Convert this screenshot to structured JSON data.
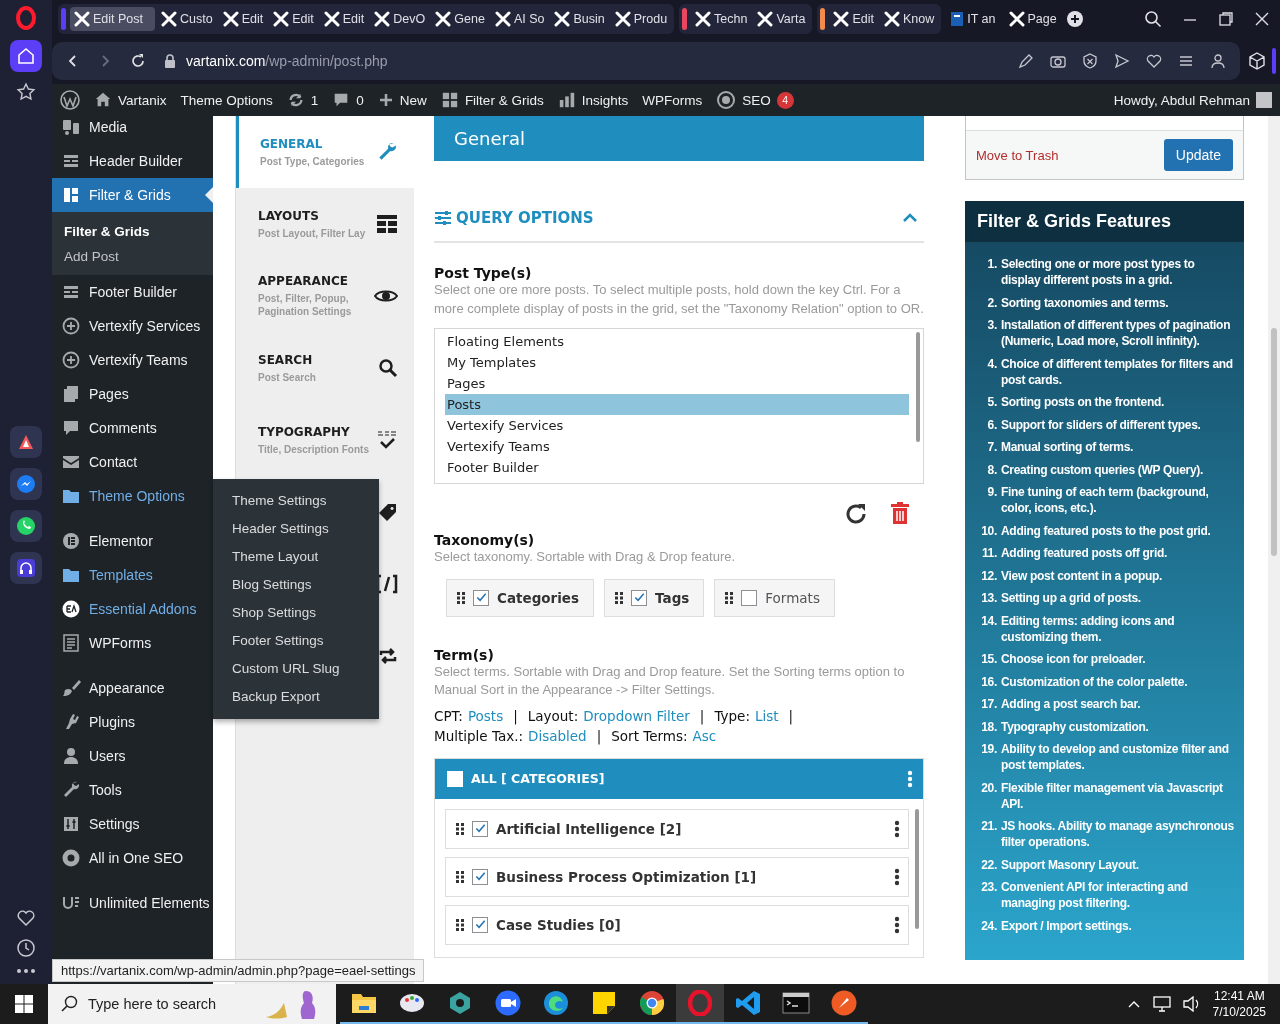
{
  "browser": {
    "tab_groups": [
      {
        "color": "#5b3ef5",
        "tabs": [
          {
            "title": "Edit Post",
            "selected": true
          },
          {
            "title": "Custo",
            "selected": false
          },
          {
            "title": "Edit",
            "selected": false
          },
          {
            "title": "Edit",
            "selected": false
          },
          {
            "title": "Edit",
            "selected": false
          },
          {
            "title": "DevO",
            "selected": false
          },
          {
            "title": "Gene",
            "selected": false
          },
          {
            "title": "AI So",
            "selected": false
          },
          {
            "title": "Busin",
            "selected": false
          },
          {
            "title": "Produ",
            "selected": false
          }
        ]
      },
      {
        "color": "#e8475f",
        "tabs": [
          {
            "title": "Techn",
            "selected": false
          },
          {
            "title": "Varta",
            "selected": false
          }
        ]
      },
      {
        "color": "#f28b4c",
        "tabs": [
          {
            "title": "Edit",
            "selected": false
          },
          {
            "title": "Know",
            "selected": false
          }
        ]
      }
    ],
    "loose_tabs": [
      {
        "title": "IT an",
        "selected": false,
        "kind": "doc"
      },
      {
        "title": "Page",
        "selected": false,
        "kind": "x"
      }
    ],
    "address": {
      "host": "vartanix.com",
      "path": "/wp-admin/post.php"
    },
    "status_url": "https://vartanix.com/wp-admin/admin.php?page=eael-settings"
  },
  "admin_bar": {
    "items": [
      {
        "kind": "home",
        "label": "Vartanix"
      },
      {
        "kind": "text",
        "label": "Theme Options"
      },
      {
        "kind": "updates",
        "label": "1"
      },
      {
        "kind": "comments",
        "label": "0"
      },
      {
        "kind": "new",
        "label": "New"
      },
      {
        "kind": "grid",
        "label": "Filter & Grids"
      },
      {
        "kind": "insights",
        "label": "Insights"
      },
      {
        "kind": "text",
        "label": "WPForms"
      },
      {
        "kind": "seo",
        "label": "SEO",
        "badge": "4"
      }
    ],
    "greeting": "Howdy, Abdul Rehman"
  },
  "admin_menu": [
    {
      "items": [
        {
          "kind": "media",
          "label": "Media",
          "current": false,
          "highlighted": false
        },
        {
          "kind": "builder",
          "label": "Header Builder",
          "current": false,
          "highlighted": false
        },
        {
          "kind": "grid",
          "label": "Filter & Grids",
          "current": true,
          "highlighted": false,
          "submenu": [
            {
              "label": "Filter & Grids",
              "current": true
            },
            {
              "label": "Add Post",
              "current": false
            }
          ]
        },
        {
          "kind": "builder",
          "label": "Footer Builder",
          "current": false,
          "highlighted": false
        },
        {
          "kind": "plus",
          "label": "Vertexify Services",
          "current": false,
          "highlighted": false
        },
        {
          "kind": "plus",
          "label": "Vertexify Teams",
          "current": false,
          "highlighted": false
        },
        {
          "kind": "pages",
          "label": "Pages",
          "current": false,
          "highlighted": false
        },
        {
          "kind": "comments",
          "label": "Comments",
          "current": false,
          "highlighted": false
        },
        {
          "kind": "mail",
          "label": "Contact",
          "current": false,
          "highlighted": false
        },
        {
          "kind": "folder",
          "label": "Theme Options",
          "current": false,
          "highlighted": true,
          "flyout": [
            "Theme Settings",
            "Header Settings",
            "Theme Layout",
            "Blog Settings",
            "Shop Settings",
            "Footer Settings",
            "Custom URL Slug",
            "Backup Export"
          ]
        }
      ]
    },
    {
      "items": [
        {
          "kind": "elementor",
          "label": "Elementor",
          "current": false,
          "highlighted": false
        },
        {
          "kind": "folder",
          "label": "Templates",
          "current": false,
          "highlighted": true
        },
        {
          "kind": "ea",
          "label": "Essential Addons",
          "current": false,
          "highlighted": true
        },
        {
          "kind": "form",
          "label": "WPForms",
          "current": false,
          "highlighted": false
        }
      ]
    },
    {
      "items": [
        {
          "kind": "brush",
          "label": "Appearance",
          "current": false,
          "highlighted": false
        },
        {
          "kind": "plug",
          "label": "Plugins",
          "current": false,
          "highlighted": false
        },
        {
          "kind": "user",
          "label": "Users",
          "current": false,
          "highlighted": false
        },
        {
          "kind": "wrench",
          "label": "Tools",
          "current": false,
          "highlighted": false
        },
        {
          "kind": "sliders",
          "label": "Settings",
          "current": false,
          "highlighted": false
        },
        {
          "kind": "seo",
          "label": "All in One SEO",
          "current": false,
          "highlighted": false
        }
      ]
    },
    {
      "items": [
        {
          "kind": "ue",
          "label": "Unlimited Elements",
          "current": false,
          "highlighted": false
        }
      ]
    }
  ],
  "settings_tabs": [
    {
      "kind": "wrench",
      "title": "GENERAL",
      "subtitle": "Post Type, Categories",
      "selected": true
    },
    {
      "kind": "table",
      "title": "LAYOUTS",
      "subtitle": "Post Layout, Filter Lay",
      "selected": false
    },
    {
      "kind": "eye",
      "title": "APPEARANCE",
      "subtitle": "Post, Filter, Popup, Pagination Settings",
      "selected": false
    },
    {
      "kind": "search",
      "title": "SEARCH",
      "subtitle": "Post Search",
      "selected": false
    },
    {
      "kind": "abc",
      "title": "TYPOGRAPHY",
      "subtitle": "Title, Description Fonts",
      "selected": false
    },
    {
      "kind": "tag",
      "selected": false
    },
    {
      "kind": "code",
      "selected": false
    },
    {
      "kind": "repeat",
      "selected": false
    }
  ],
  "panel": {
    "title": "General",
    "section_title": "QUERY OPTIONS",
    "section_expanded": true,
    "post_types": {
      "label": "Post Type(s)",
      "description": "Select one ore more posts. To select multiple posts, hold down the key Ctrl. For a more complete display of posts in the grid, set the \"Taxonomy Relation\" option to OR.",
      "options": [
        {
          "label": "Floating Elements",
          "selected": false
        },
        {
          "label": "My Templates",
          "selected": false
        },
        {
          "label": "Pages",
          "selected": false
        },
        {
          "label": "Posts",
          "selected": true
        },
        {
          "label": "Vertexify Services",
          "selected": false
        },
        {
          "label": "Vertexify Teams",
          "selected": false
        },
        {
          "label": "Footer Builder",
          "selected": false
        }
      ]
    },
    "taxonomies": {
      "label": "Taxonomy(s)",
      "description": "Select taxonomy. Sortable with Drag & Drop feature.",
      "items": [
        {
          "label": "Categories",
          "checked": true
        },
        {
          "label": "Tags",
          "checked": true
        },
        {
          "label": "Formats",
          "checked": false
        }
      ]
    },
    "terms": {
      "label": "Term(s)",
      "description": "Select terms. Sortable with Drag and Drop feature. Set the Sorting terms option to Manual Sort in the Appearance -> Filter Settings.",
      "info_rows": [
        [
          {
            "key": "CPT:",
            "value": "Posts",
            "separator": "|"
          },
          {
            "key": "Layout:",
            "value": "Dropdown Filter",
            "separator": "|"
          },
          {
            "key": "Type:",
            "value": "List",
            "separator": "|"
          }
        ],
        [
          {
            "key": "Multiple Tax.:",
            "value": "Disabled",
            "separator": "|"
          },
          {
            "key": "Sort Terms:",
            "value": "Asc"
          }
        ]
      ],
      "all_label": "ALL [ CATEGORIES]",
      "all_checked": false,
      "items": [
        {
          "label": "Artificial Intelligence [2]",
          "checked": true
        },
        {
          "label": "Business Process Optimization [1]",
          "checked": true
        },
        {
          "label": "Case Studies [0]",
          "checked": true
        }
      ]
    }
  },
  "publish": {
    "trash": "Move to Trash",
    "update": "Update"
  },
  "features": {
    "title": "Filter & Grids Features",
    "items": [
      {
        "number": "1.",
        "text": "Selecting one or more post types to display different posts in a grid."
      },
      {
        "number": "2.",
        "text": "Sorting taxonomies and terms."
      },
      {
        "number": "3.",
        "text": "Installation of different types of pagination (Numeric, Load more, Scroll infinity)."
      },
      {
        "number": "4.",
        "text": "Choice of different templates for filters and post cards."
      },
      {
        "number": "5.",
        "text": "Sorting posts on the frontend."
      },
      {
        "number": "6.",
        "text": "Support for sliders of different types."
      },
      {
        "number": "7.",
        "text": "Manual sorting of terms."
      },
      {
        "number": "8.",
        "text": "Creating custom queries (WP Query)."
      },
      {
        "number": "9.",
        "text": "Fine tuning of each term (background, color, icons, etc.)."
      },
      {
        "number": "10.",
        "text": "Adding featured posts to the post grid."
      },
      {
        "number": "11.",
        "text": "Adding featured posts off grid."
      },
      {
        "number": "12.",
        "text": "View post content in a popup."
      },
      {
        "number": "13.",
        "text": "Setting up a grid of posts."
      },
      {
        "number": "14.",
        "text": "Editing terms: adding icons and customizing them."
      },
      {
        "number": "15.",
        "text": "Choose icon for preloader."
      },
      {
        "number": "16.",
        "text": "Customization of the color palette."
      },
      {
        "number": "17.",
        "text": "Adding a post search bar."
      },
      {
        "number": "18.",
        "text": "Typography customization."
      },
      {
        "number": "19.",
        "text": "Ability to develop and customize filter and post templates."
      },
      {
        "number": "20.",
        "text": "Flexible filter management via Javascript API."
      },
      {
        "number": "21.",
        "text": "JS hooks. Ability to manage asynchronous filter operations."
      },
      {
        "number": "22.",
        "text": "Support Masonry Layout."
      },
      {
        "number": "23.",
        "text": "Convenient API for interacting and managing post filtering."
      },
      {
        "number": "24.",
        "text": "Export / Import settings."
      }
    ]
  },
  "taskbar": {
    "search_placeholder": "Type here to search",
    "apps": [
      {
        "kind": "folder",
        "selected": false
      },
      {
        "kind": "paint",
        "selected": false
      },
      {
        "kind": "hex",
        "selected": false
      },
      {
        "kind": "video",
        "selected": false
      },
      {
        "kind": "edge",
        "selected": false
      },
      {
        "kind": "notes",
        "selected": false
      },
      {
        "kind": "chrome",
        "selected": false
      },
      {
        "kind": "opera",
        "selected": true
      },
      {
        "kind": "code",
        "selected": false
      },
      {
        "kind": "terminal",
        "selected": false
      },
      {
        "kind": "rocket",
        "selected": false
      }
    ],
    "time": "12:41 AM",
    "date": "7/10/2025"
  }
}
